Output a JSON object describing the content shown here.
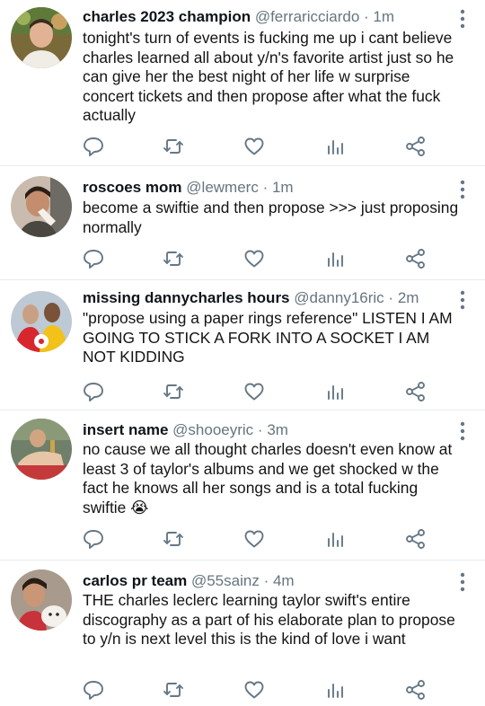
{
  "tweets": [
    {
      "name": "charles 2023 champion",
      "handle": "@ferraricciardo",
      "separator": "·",
      "time": "1m",
      "text": "tonight's turn of events is fucking me up i cant believe charles learned all about y/n's favorite artist just so he can give her the best night of her life w surprise concert tickets and then propose after what the fuck actually",
      "icons": [
        "reply-icon",
        "retweet-icon",
        "like-icon",
        "stats-icon",
        "share-icon"
      ]
    },
    {
      "name": "roscoes mom",
      "handle": "@lewmerc",
      "separator": "·",
      "time": "1m",
      "text": "become a swiftie and then propose >>> just proposing normally",
      "icons": [
        "reply-icon",
        "retweet-icon",
        "like-icon",
        "stats-icon",
        "share-icon"
      ]
    },
    {
      "name": "missing dannycharles hours",
      "handle": "@danny16ric",
      "separator": "·",
      "time": "2m",
      "text": "\"propose using a paper rings reference\" LISTEN I AM GOING TO STICK A FORK INTO A SOCKET I AM NOT KIDDING",
      "icons": [
        "reply-icon",
        "retweet-icon",
        "like-icon",
        "stats-icon",
        "share-icon"
      ]
    },
    {
      "name": "insert name",
      "handle": "@shooeyric",
      "separator": "·",
      "time": "3m",
      "text": "no cause we all thought charles doesn't even know at least 3 of taylor's albums and we get shocked w the fact he knows all her songs and is a total fucking swiftie 😭",
      "icons": [
        "reply-icon",
        "retweet-icon",
        "like-icon",
        "stats-icon",
        "share-icon"
      ]
    },
    {
      "name": "carlos pr team",
      "handle": "@55sainz",
      "separator": "·",
      "time": "4m",
      "text": "THE charles leclerc learning taylor swift's entire discography as a part of his elaborate plan to propose to y/n is next level this is the kind of love i want",
      "icons": [
        "reply-icon",
        "retweet-icon",
        "like-icon",
        "stats-icon",
        "share-icon"
      ]
    }
  ],
  "colors": {
    "icon": "#657786",
    "secondary_text": "#66757f",
    "divider": "#e6ecf0"
  }
}
